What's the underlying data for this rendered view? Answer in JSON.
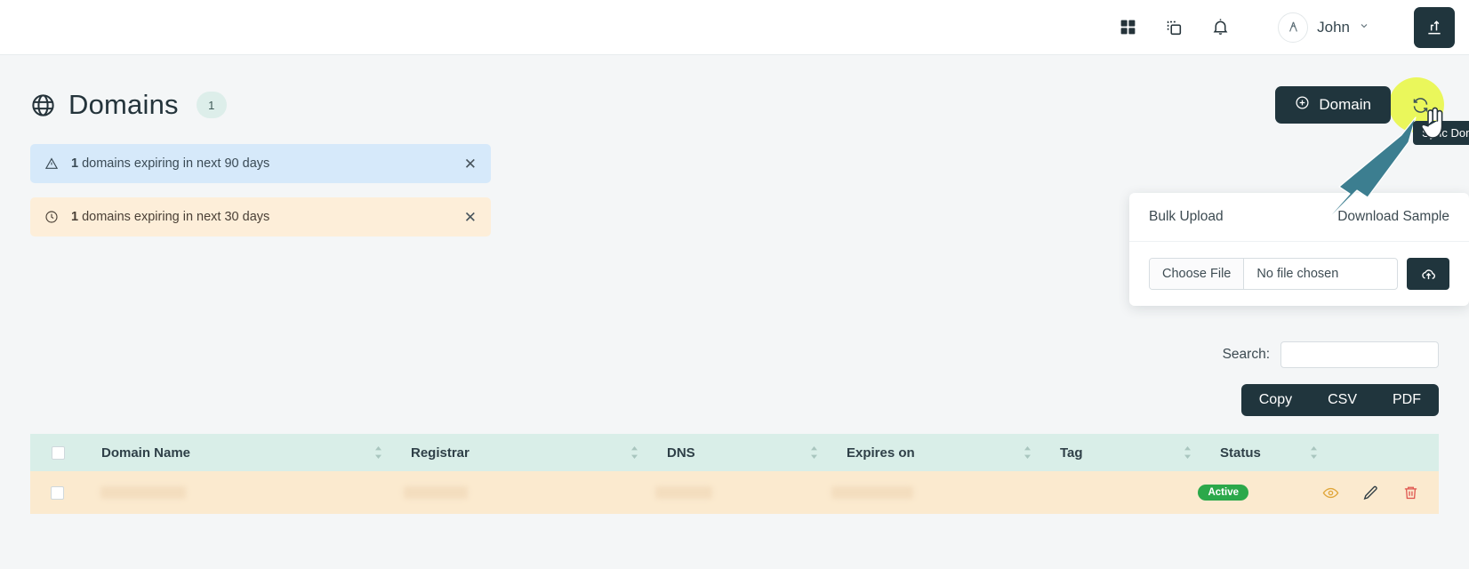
{
  "topbar": {
    "icons": [
      {
        "name": "apps-grid-icon",
        "label": "Apps"
      },
      {
        "name": "copy-layers-icon",
        "label": "Layers"
      },
      {
        "name": "bell-icon",
        "label": "Notifications"
      }
    ],
    "avatar_initial": "A",
    "user_name": "John",
    "chevron": "⌄",
    "export_icon": "export-upload-icon"
  },
  "page": {
    "title": "Domains",
    "count_badge": "1",
    "globe_icon": "globe-icon"
  },
  "actions": {
    "domain_button": "Domain",
    "domain_button_icon": "plus-circle-icon",
    "sync_button_icon": "sync-refresh-icon",
    "sync_tooltip": "Sync Domain"
  },
  "alerts": [
    {
      "icon": "warning-triangle-icon",
      "strong": "1",
      "text": "domains expiring in next 90 days",
      "variant": "blue",
      "close": "✕"
    },
    {
      "icon": "clock-icon",
      "strong": "1",
      "text": "domains expiring in next 30 days",
      "variant": "orange",
      "close": "✕"
    }
  ],
  "bulk_upload": {
    "title": "Bulk Upload",
    "download_sample": "Download Sample",
    "choose_file": "Choose File",
    "file_name": "No file chosen",
    "upload_icon": "cloud-upload-icon"
  },
  "search": {
    "label": "Search:",
    "value": "",
    "placeholder": ""
  },
  "export_buttons": [
    "Copy",
    "CSV",
    "PDF"
  ],
  "table": {
    "columns": [
      {
        "key": "select",
        "label": ""
      },
      {
        "key": "domain_name",
        "label": "Domain Name"
      },
      {
        "key": "registrar",
        "label": "Registrar"
      },
      {
        "key": "dns",
        "label": "DNS"
      },
      {
        "key": "expires_on",
        "label": "Expires on"
      },
      {
        "key": "tag",
        "label": "Tag"
      },
      {
        "key": "status",
        "label": "Status"
      },
      {
        "key": "actions",
        "label": ""
      }
    ],
    "rows": [
      {
        "domain_name": "",
        "registrar": "",
        "dns": "",
        "expires_on": "",
        "tag": "",
        "status": "Active",
        "actions": [
          "view-eye-icon",
          "edit-pencil-icon",
          "delete-trash-icon"
        ]
      }
    ]
  },
  "colors": {
    "dark_navy": "#20353d",
    "highlight_yellow": "#e8f73f",
    "alert_blue": "#d6e9fa",
    "alert_orange": "#fdeed9",
    "table_header_teal": "#d9eee8",
    "table_row_peach": "#fbeacf",
    "status_green": "#2ba84a",
    "arrow_teal": "#3c7e90"
  }
}
